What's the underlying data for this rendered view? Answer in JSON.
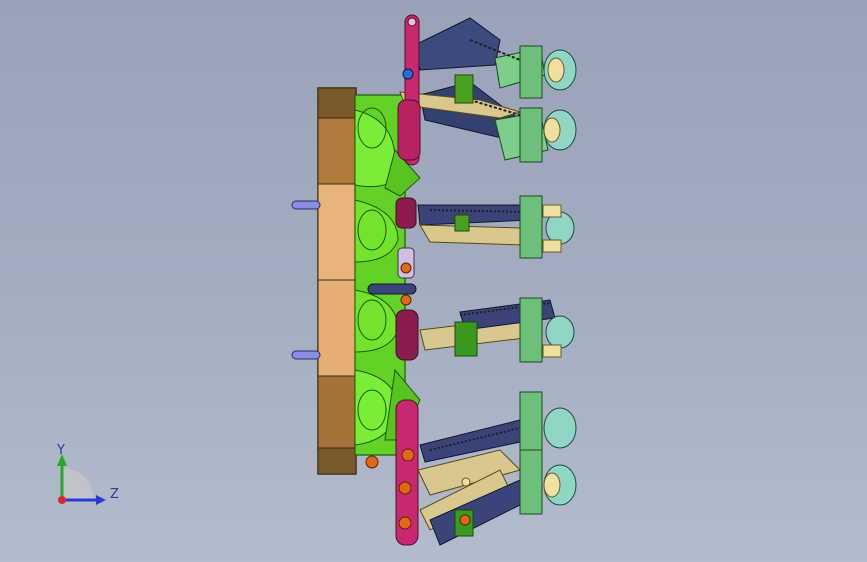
{
  "viewport": {
    "background_top": "#98a3b8",
    "background_bottom": "#b3bccc",
    "part_colors": {
      "base_block_dark": "#7a5a2c",
      "base_block_light": "#e8b27a",
      "green_body": "#6ee22a",
      "magenta_arm": "#c8286e",
      "navy_link": "#3a4478",
      "tan_link": "#d8c890",
      "mint_housing": "#7ccf8a",
      "teal_roller": "#8fd6c4",
      "orange_bolt": "#e06818"
    }
  },
  "triad": {
    "y_label": "Y",
    "z_label": "Z",
    "y_color": "#2aa82a",
    "z_color": "#2a3ad8",
    "x_color": "#d82a2a"
  }
}
